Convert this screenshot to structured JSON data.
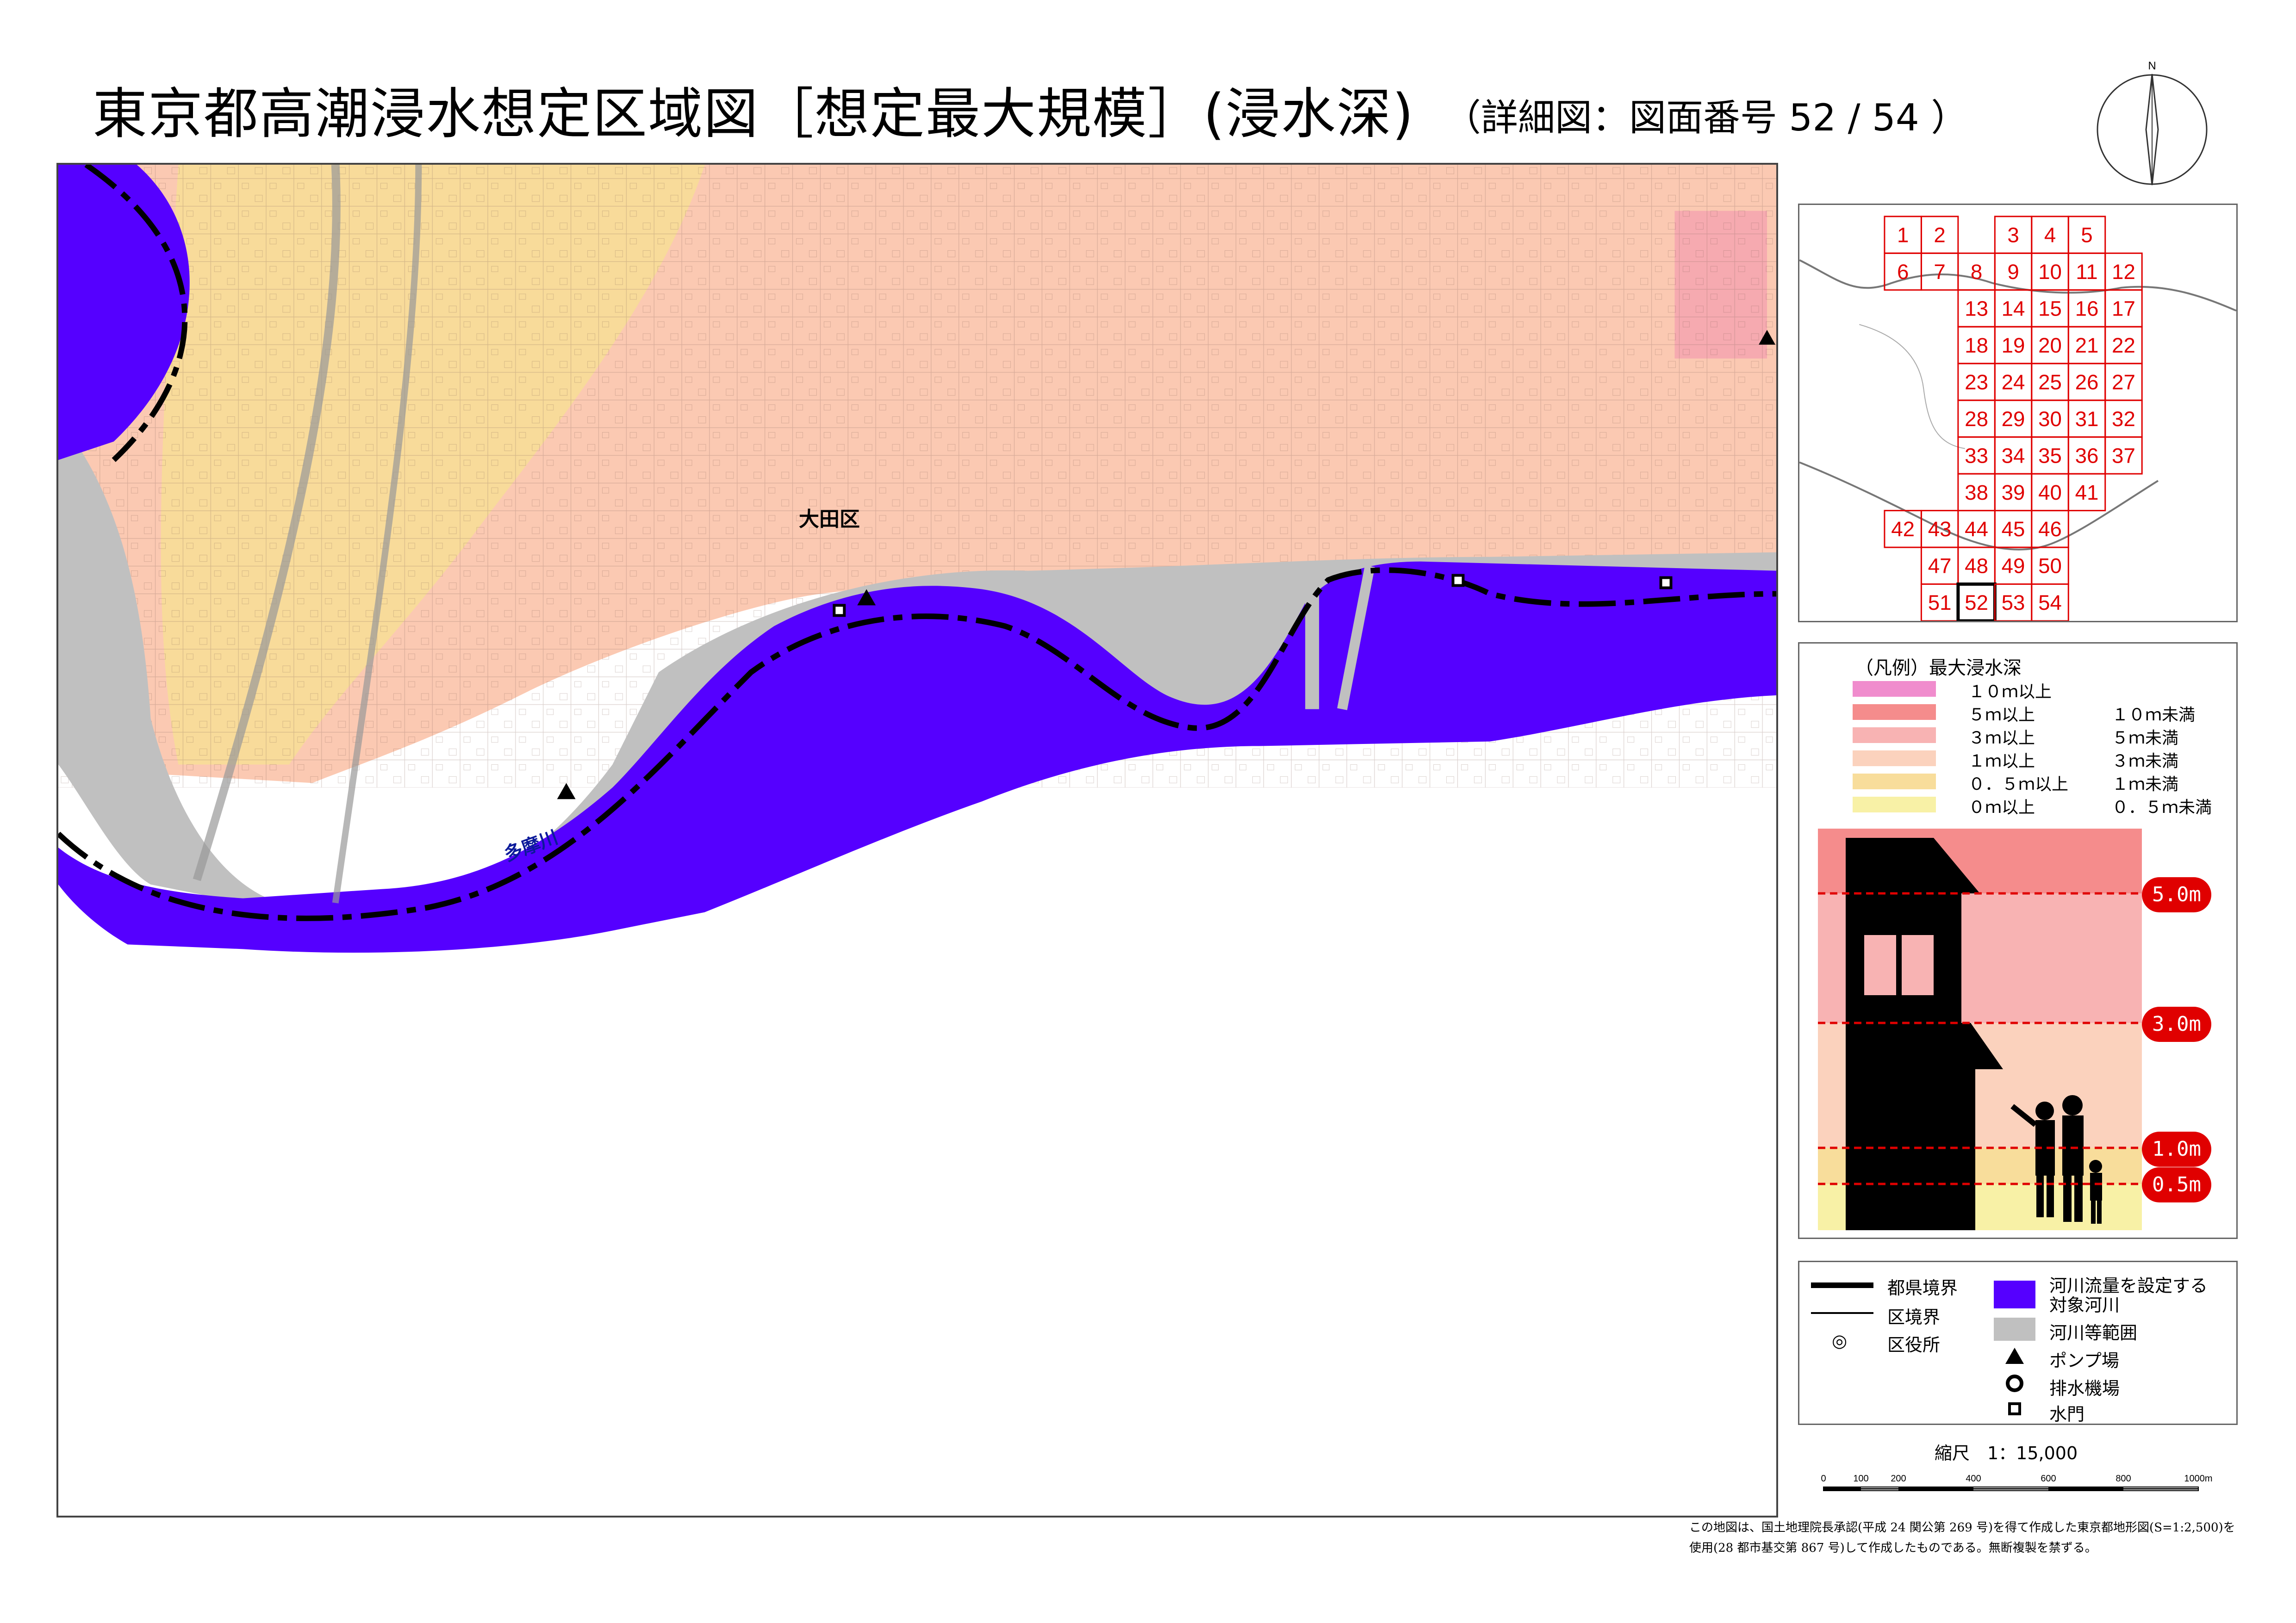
{
  "header": {
    "title": "東京都高潮浸水想定区域図［想定最大規模］(浸水深)",
    "subtitle": "（詳細図：図面番号 52 / 54 ）"
  },
  "compass": {
    "north_label": "N"
  },
  "map": {
    "ward_label": "大田区",
    "river_label": "多摩川",
    "colors": {
      "river": "#5500ff",
      "river_area": "#c0c0c0",
      "depth_0_05": "#f7ec9a",
      "depth_05_1": "#f8db9a",
      "depth_1_3": "#fbc9b2",
      "depth_3_5": "#f6aab0"
    }
  },
  "index_map": {
    "grid_color": "#e00000",
    "current_sheet": "52",
    "rows": [
      [
        "1",
        "2",
        "",
        "3",
        "4",
        "5",
        "",
        ""
      ],
      [
        "6",
        "7",
        "8",
        "9",
        "10",
        "11",
        "12",
        ""
      ],
      [
        "",
        "",
        "13",
        "14",
        "15",
        "16",
        "17",
        ""
      ],
      [
        "",
        "",
        "18",
        "19",
        "20",
        "21",
        "22",
        ""
      ],
      [
        "",
        "",
        "23",
        "24",
        "25",
        "26",
        "27",
        ""
      ],
      [
        "",
        "",
        "28",
        "29",
        "30",
        "31",
        "32",
        ""
      ],
      [
        "",
        "",
        "33",
        "34",
        "35",
        "36",
        "37",
        ""
      ],
      [
        "",
        "",
        "38",
        "39",
        "40",
        "41",
        "",
        ""
      ],
      [
        "42",
        "43",
        "44",
        "45",
        "46",
        "",
        "",
        ""
      ],
      [
        "",
        "47",
        "48",
        "49",
        "50",
        "",
        "",
        ""
      ],
      [
        "",
        "51",
        "52",
        "53",
        "54",
        "",
        "",
        ""
      ]
    ]
  },
  "depth_legend": {
    "title": "（凡例）最大浸水深",
    "items": [
      {
        "min": "１０ｍ以上",
        "max": "",
        "color": "#f08ccd"
      },
      {
        "min": "５ｍ以上",
        "max": "１０ｍ未満",
        "color": "#f58c8c"
      },
      {
        "min": "３ｍ以上",
        "max": "５ｍ未満",
        "color": "#f8b3b3"
      },
      {
        "min": "１ｍ以上",
        "max": "３ｍ未満",
        "color": "#fbd2bd"
      },
      {
        "min": "０．５ｍ以上",
        "max": "１ｍ未満",
        "color": "#f8dd9b"
      },
      {
        "min": "０ｍ以上",
        "max": "０．５ｍ未満",
        "color": "#f8f1a6"
      }
    ],
    "markers": [
      "5.0m",
      "3.0m",
      "1.0m",
      "0.5m"
    ]
  },
  "symbols": {
    "pref_border": "都県境界",
    "ward_border": "区境界",
    "ward_office": "区役所",
    "target_river": "河川流量を設定する\n対象河川",
    "target_river_l1": "河川流量を設定する",
    "target_river_l2": "対象河川",
    "river_area": "河川等範囲",
    "pump": "ポンプ場",
    "drain": "排水機場",
    "gate": "水門",
    "ward_office_icon": "◎"
  },
  "scale": {
    "label": "縮尺　1：15,000",
    "ticks": [
      "0",
      "100",
      "200",
      "400",
      "600",
      "800",
      "1000m"
    ]
  },
  "footer": {
    "note": "この地図は、国土地理院長承認(平成 24 関公第 269 号)を得て作成した東京都地形図(S=1:2,500)を使用(28 都市基交第 867 号)して作成したものである。無断複製を禁ずる。"
  }
}
